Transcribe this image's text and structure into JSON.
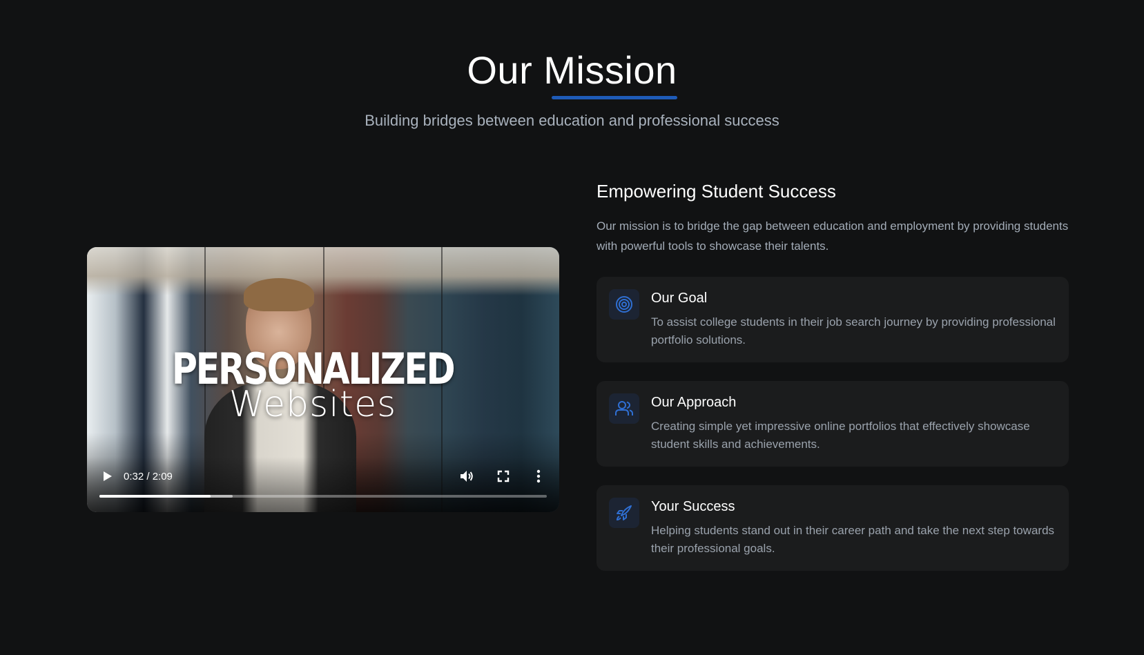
{
  "header": {
    "title": "Our Mission",
    "subtitle": "Building bridges between education and professional success"
  },
  "video": {
    "overlay_line1": "PERSONALIZED",
    "overlay_line2": "Websites",
    "time": "0:32 / 2:09",
    "progress_fraction": 0.248,
    "buffered_fraction": 0.298
  },
  "content": {
    "heading": "Empowering Student Success",
    "description": "Our mission is to bridge the gap between education and employment by providing students with powerful tools to showcase their talents.",
    "cards": [
      {
        "icon": "target-icon",
        "title": "Our Goal",
        "text": "To assist college students in their job search journey by providing professional portfolio solutions."
      },
      {
        "icon": "users-icon",
        "title": "Our Approach",
        "text": "Creating simple yet impressive online portfolios that effectively showcase student skills and achievements."
      },
      {
        "icon": "rocket-icon",
        "title": "Your Success",
        "text": "Helping students stand out in their career path and take the next step towards their professional goals."
      }
    ]
  },
  "colors": {
    "background": "#111213",
    "accent": "#1e5bb8",
    "card_background": "#1b1c1d",
    "icon_tile": "#1c2433"
  }
}
